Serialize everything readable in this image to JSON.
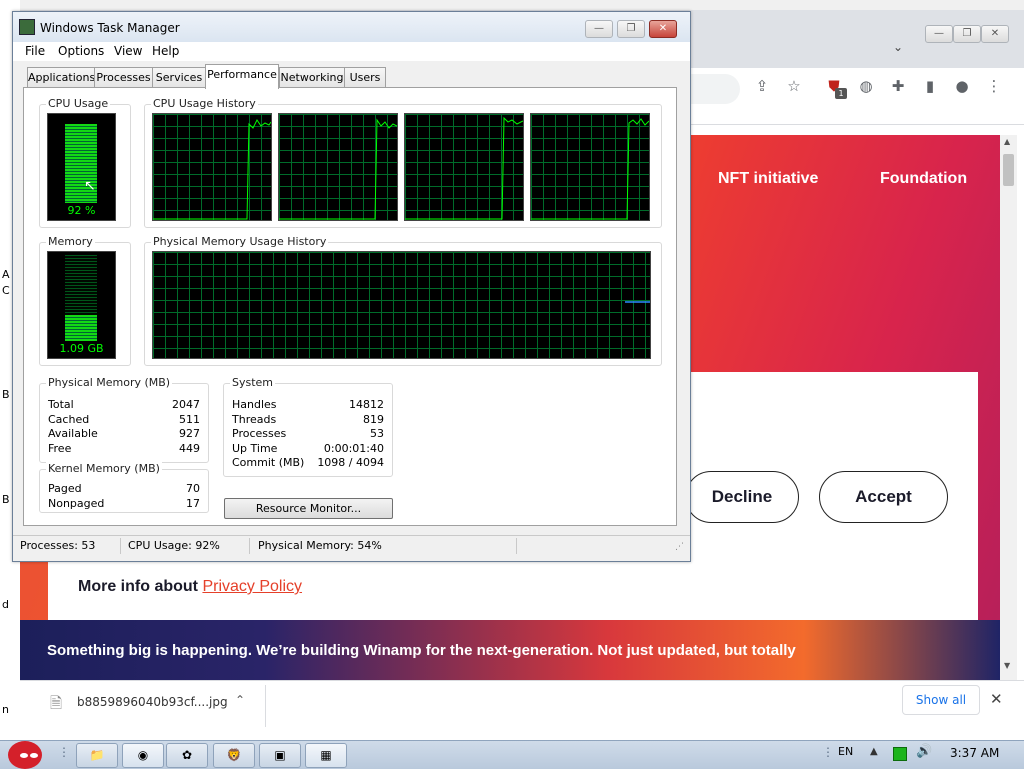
{
  "desktop": {
    "strip_chars": [
      "A",
      "C",
      "B",
      "B",
      "d",
      "n"
    ]
  },
  "browser": {
    "toolbar": {
      "share_icon": "share-icon",
      "star_icon": "star-icon",
      "extension_badge": "1"
    },
    "page": {
      "nav": [
        "NFT initiative",
        "Foundation"
      ],
      "cookie": {
        "decline_label": "Decline",
        "accept_label": "Accept",
        "privacy_prefix": "More info about",
        "privacy_link": "Privacy Policy"
      },
      "banner_text": "Something big is happening. We’re building Winamp for the next-generation. Not just updated, but totally"
    },
    "download_bar": {
      "filename": "b8859896040b93cf....jpg",
      "show_all_label": "Show all"
    }
  },
  "taskmanager": {
    "title": "Windows Task Manager",
    "menu": [
      "File",
      "Options",
      "View",
      "Help"
    ],
    "tabs": [
      "Applications",
      "Processes",
      "Services",
      "Performance",
      "Networking",
      "Users"
    ],
    "active_tab": "Performance",
    "cpu_usage": {
      "label": "CPU Usage",
      "percent_text": "92 %",
      "level": 0.92
    },
    "cpu_history_label": "CPU Usage History",
    "memory": {
      "label": "Memory",
      "value_text": "1.09 GB",
      "level": 0.54
    },
    "mem_history_label": "Physical Memory Usage History",
    "physical_memory": {
      "title": "Physical Memory (MB)",
      "rows": [
        {
          "label": "Total",
          "value": "2047"
        },
        {
          "label": "Cached",
          "value": "511"
        },
        {
          "label": "Available",
          "value": "927"
        },
        {
          "label": "Free",
          "value": "449"
        }
      ]
    },
    "kernel_memory": {
      "title": "Kernel Memory (MB)",
      "rows": [
        {
          "label": "Paged",
          "value": "70"
        },
        {
          "label": "Nonpaged",
          "value": "17"
        }
      ]
    },
    "system": {
      "title": "System",
      "rows": [
        {
          "label": "Handles",
          "value": "14812"
        },
        {
          "label": "Threads",
          "value": "819"
        },
        {
          "label": "Processes",
          "value": "53"
        },
        {
          "label": "Up Time",
          "value": "0:00:01:40"
        },
        {
          "label": "Commit (MB)",
          "value": "1098 / 4094"
        }
      ]
    },
    "resource_monitor_label": "Resource Monitor...",
    "status": {
      "processes": "Processes: 53",
      "cpu": "CPU Usage: 92%",
      "memory": "Physical Memory: 54%"
    }
  },
  "taskbar": {
    "language": "EN",
    "clock": "3:37 AM"
  },
  "colors": {
    "graph_green": "#00ff00",
    "grid_green": "#006c2a",
    "accent_orange": "#f25c24"
  }
}
